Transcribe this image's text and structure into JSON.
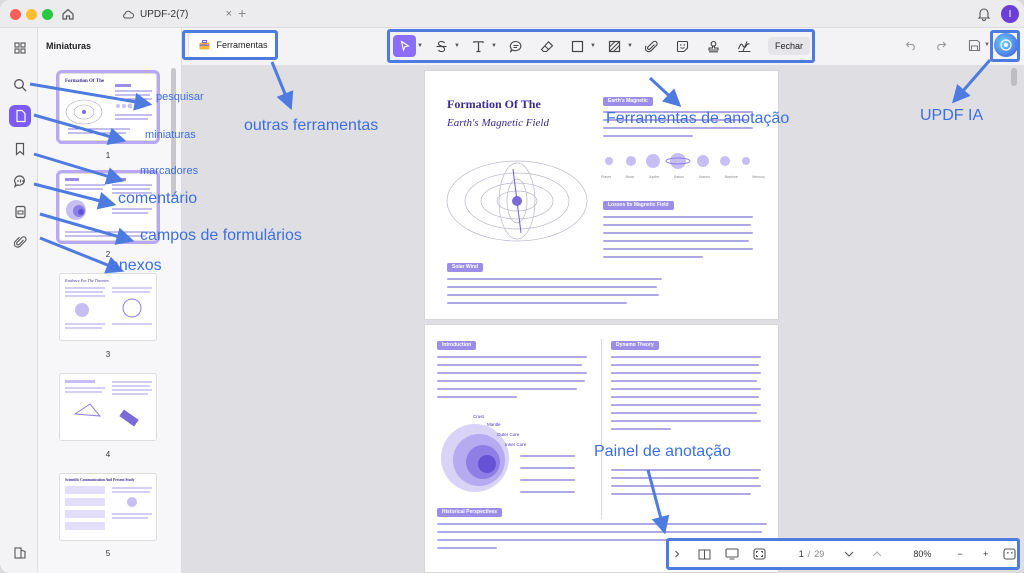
{
  "titlebar": {
    "tab_title": "UPDF-2(7)",
    "close": "×",
    "new_tab": "+",
    "avatar": "I"
  },
  "sidebar": {
    "title": "Miniaturas",
    "pages": [
      "1",
      "2",
      "3",
      "4",
      "5"
    ],
    "thumb_titles": [
      "Formation Of The",
      "",
      "Evidence For The Theories",
      "",
      "Scientific Communication And Present Study"
    ]
  },
  "toolbar": {
    "tools_label": "Ferramentas",
    "close_label": "Fechar"
  },
  "document": {
    "page1": {
      "title1": "Formation Of The",
      "title2": "Earth's Magnetic Field",
      "pill1": "Earth's Magnetic",
      "pill2": "Losses Its Magnetic Field",
      "pill3": "Solar Wind",
      "planets": [
        "Planet",
        "Moon",
        "Jupiter",
        "Saturn",
        "Uranus",
        "Neptune",
        "Mercury"
      ]
    },
    "page2": {
      "pill1": "Introduction",
      "pill2": "Dynamo Theory",
      "pill3": "Historical Perspectives",
      "layers": [
        "Crust",
        "Mantle",
        "Outer Core",
        "Inner Core"
      ]
    }
  },
  "bottombar": {
    "current_page": "1",
    "separator": "/",
    "total_pages": "29",
    "zoom": "80%",
    "minus": "−",
    "plus": "+"
  },
  "annotations": {
    "pesquisar": "pesquisar",
    "miniaturas": "miniaturas",
    "marcadores": "marcadores",
    "comentario": "comentário",
    "campos": "campos de formulários",
    "anexos": "anexos",
    "outras_ferramentas": "outras ferramentas",
    "ferramentas_anotacao": "Ferramentas de anotação",
    "updf_ia": "UPDF IA",
    "painel_anotacao": "Painel de anotação",
    "color": "#3d6fe0"
  }
}
